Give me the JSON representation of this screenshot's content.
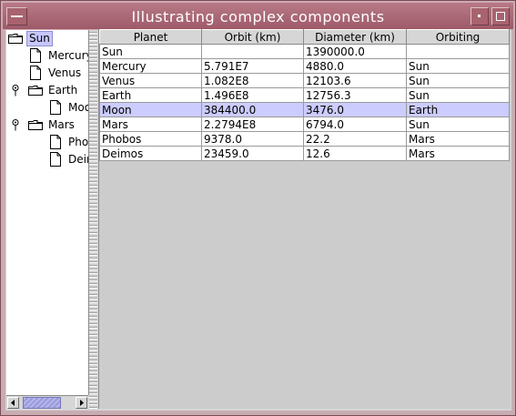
{
  "window": {
    "title": "Illustrating complex components",
    "colors": {
      "titlebar": "#a96574",
      "frame": "#c8acb2",
      "selection": "#ccccff"
    }
  },
  "tree": {
    "nodes": [
      {
        "label": "Sun",
        "icon": "folder-icon",
        "selected": true,
        "expanded": true
      },
      {
        "label": "Mercury",
        "icon": "document-icon"
      },
      {
        "label": "Venus",
        "icon": "document-icon"
      },
      {
        "label": "Earth",
        "icon": "folder-icon",
        "expanded": true
      },
      {
        "label": "Moon",
        "icon": "document-icon"
      },
      {
        "label": "Mars",
        "icon": "folder-icon",
        "expanded": true
      },
      {
        "label": "Phobos",
        "icon": "document-icon"
      },
      {
        "label": "Deimos",
        "icon": "document-icon"
      }
    ]
  },
  "table": {
    "columns": [
      "Planet",
      "Orbit (km)",
      "Diameter (km)",
      "Orbiting"
    ],
    "rows": [
      [
        "Sun",
        "",
        "1390000.0",
        ""
      ],
      [
        "Mercury",
        "5.791E7",
        "4880.0",
        "Sun"
      ],
      [
        "Venus",
        "1.082E8",
        "12103.6",
        "Sun"
      ],
      [
        "Earth",
        "1.496E8",
        "12756.3",
        "Sun"
      ],
      [
        "Moon",
        "384400.0",
        "3476.0",
        "Earth"
      ],
      [
        "Mars",
        "2.2794E8",
        "6794.0",
        "Sun"
      ],
      [
        "Phobos",
        "9378.0",
        "22.2",
        "Mars"
      ],
      [
        "Deimos",
        "23459.0",
        "12.6",
        "Mars"
      ]
    ],
    "selected_row": 4
  }
}
